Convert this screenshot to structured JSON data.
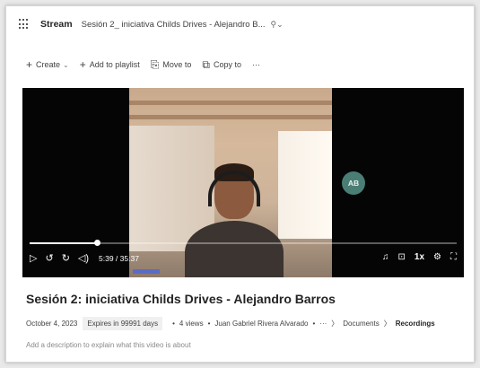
{
  "appbar": {
    "app_name": "Stream",
    "doc_title": "Sesión 2_ iniciativa Childs Drives - Alejandro B...",
    "pin_icon": "pin-icon"
  },
  "commands": {
    "create": "Create",
    "add_to_playlist": "Add to playlist",
    "move_to": "Move to",
    "copy_to": "Copy to",
    "more": "···"
  },
  "player": {
    "avatar_initials": "AB",
    "avatar_color": "#4a7e74",
    "timecode": "5:39 / 35:37",
    "progress_fraction": 0.158,
    "speed": "1x"
  },
  "video": {
    "title": "Sesión 2: iniciativa Childs Drives - Alejandro Barros",
    "date": "October 4, 2023",
    "expires": "Expires in 99991 days",
    "views": "4 views",
    "owner": "Juan Gabriel Rivera Alvarado",
    "more": "···",
    "crumb_documents": "Documents",
    "crumb_recordings": "Recordings",
    "description_placeholder": "Add a description to explain what this video is about"
  }
}
